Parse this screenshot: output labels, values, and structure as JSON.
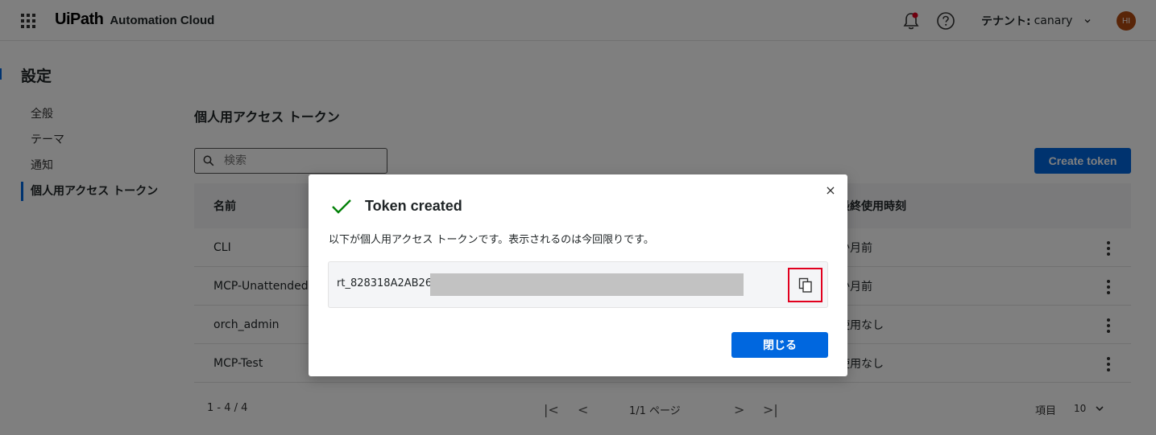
{
  "header": {
    "brand_logo": "UiPath",
    "brand_product": "Automation Cloud",
    "tenant_label": "テナント:",
    "tenant_name": "canary",
    "avatar_initials": "HI"
  },
  "page": {
    "title": "設定",
    "nav": [
      {
        "label": "全般"
      },
      {
        "label": "テーマ"
      },
      {
        "label": "通知"
      },
      {
        "label": "個人用アクセス トークン"
      }
    ],
    "section_title": "個人用アクセス トークン",
    "search_placeholder": "検索",
    "create_button": "Create token"
  },
  "table": {
    "columns": {
      "name": "名前",
      "last_used": "最終使用時刻"
    },
    "rows": [
      {
        "name": "CLI",
        "last_used": "か月前"
      },
      {
        "name": "MCP-Unattended",
        "last_used": "か月前"
      },
      {
        "name": "orch_admin",
        "last_used": "使用なし"
      },
      {
        "name": "MCP-Test",
        "last_used": "使用なし"
      }
    ]
  },
  "footer": {
    "range": "1 - 4 / 4",
    "first": "|<",
    "prev": "<",
    "page_label": "1/1 ページ",
    "next": ">",
    "last": ">|",
    "items_label": "項目",
    "items_value": "10"
  },
  "modal": {
    "close": "×",
    "title": "Token created",
    "description": "以下が個人用アクセス トークンです。表示されるのは今回限りです。",
    "token_prefix": "rt_828318A2AB26",
    "close_button": "閉じる"
  },
  "colors": {
    "primary": "#0067df",
    "success": "#038108",
    "highlight": "#e1001e",
    "notification": "#e1001e"
  }
}
